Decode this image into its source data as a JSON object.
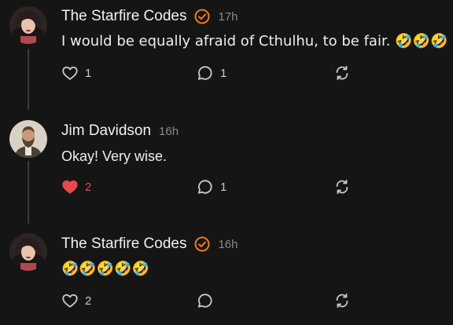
{
  "comments": [
    {
      "author": "The Starfire Codes",
      "verified": true,
      "time": "17h",
      "text": "I would be equally afraid of Cthulhu, to be fair. 🤣🤣🤣",
      "likes": "1",
      "liked": false,
      "replies": "1",
      "avatar": "woman-portrait"
    },
    {
      "author": "Jim Davidson",
      "verified": false,
      "time": "16h",
      "text": "Okay! Very wise.",
      "likes": "2",
      "liked": true,
      "replies": "1",
      "avatar": "bearded-man-portrait"
    },
    {
      "author": "The Starfire Codes",
      "verified": true,
      "time": "16h",
      "text": "🤣🤣🤣🤣🤣",
      "likes": "2",
      "liked": false,
      "replies": "",
      "avatar": "woman-portrait"
    }
  ],
  "colors": {
    "background": "#151515",
    "accent_verified": "#f07a1a",
    "liked": "#e5484d",
    "icon": "#c8c8c8",
    "muted": "#8a8a8a"
  }
}
